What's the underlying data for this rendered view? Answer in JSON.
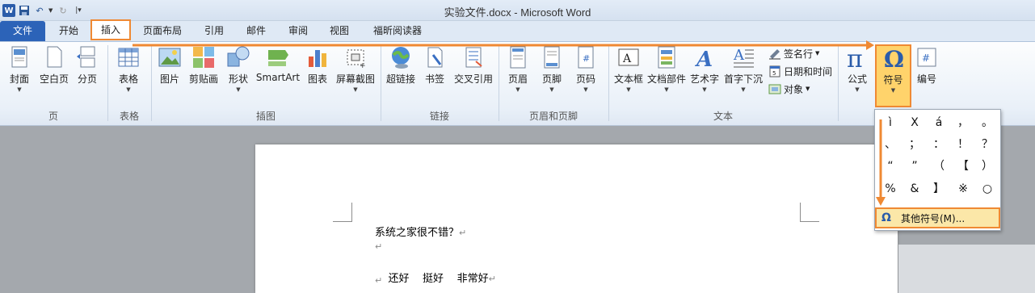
{
  "window": {
    "title": "实验文件.docx  -  Microsoft Word"
  },
  "tabs": [
    {
      "label": "文件"
    },
    {
      "label": "开始"
    },
    {
      "label": "插入"
    },
    {
      "label": "页面布局"
    },
    {
      "label": "引用"
    },
    {
      "label": "邮件"
    },
    {
      "label": "审阅"
    },
    {
      "label": "视图"
    },
    {
      "label": "福昕阅读器"
    }
  ],
  "ribbon": {
    "groups": {
      "page": "页",
      "table": "表格",
      "illustrations": "插图",
      "links": "链接",
      "header_footer": "页眉和页脚",
      "text": "文本"
    },
    "buttons": {
      "cover": "封面",
      "blank_page": "空白页",
      "page_break": "分页",
      "table": "表格",
      "picture": "图片",
      "clipart": "剪贴画",
      "shapes": "形状",
      "smartart": "SmartArt",
      "chart": "图表",
      "screenshot": "屏幕截图",
      "hyperlink": "超链接",
      "bookmark": "书签",
      "cross_ref": "交叉引用",
      "header": "页眉",
      "footer": "页脚",
      "page_number": "页码",
      "textbox": "文本框",
      "quick_parts": "文档部件",
      "wordart": "艺术字",
      "dropcap": "首字下沉",
      "signature": "签名行",
      "datetime": "日期和时间",
      "object": "对象",
      "equation": "公式",
      "symbol": "符号",
      "numbering": "编号"
    }
  },
  "document": {
    "lines": [
      "系统之家很不错？",
      "",
      "还好    挺好    非常好",
      ""
    ]
  },
  "symbol_menu": {
    "symbols": [
      "ì",
      "X",
      "á",
      "，",
      "。",
      "、",
      "；",
      "：",
      "！",
      "？",
      "“",
      "”",
      "（",
      "【",
      "）",
      "%",
      "&",
      "】",
      "※",
      "○"
    ],
    "more": "其他符号(M)..."
  },
  "colors": {
    "accent_orange": "#ef8933",
    "word_blue": "#2c63b8"
  }
}
